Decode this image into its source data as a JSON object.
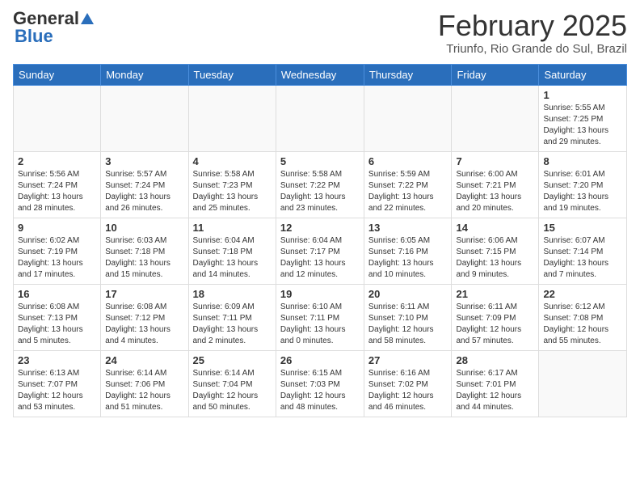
{
  "header": {
    "logo_general": "General",
    "logo_blue": "Blue",
    "month_title": "February 2025",
    "location": "Triunfo, Rio Grande do Sul, Brazil"
  },
  "days_of_week": [
    "Sunday",
    "Monday",
    "Tuesday",
    "Wednesday",
    "Thursday",
    "Friday",
    "Saturday"
  ],
  "weeks": [
    [
      {
        "num": "",
        "info": ""
      },
      {
        "num": "",
        "info": ""
      },
      {
        "num": "",
        "info": ""
      },
      {
        "num": "",
        "info": ""
      },
      {
        "num": "",
        "info": ""
      },
      {
        "num": "",
        "info": ""
      },
      {
        "num": "1",
        "info": "Sunrise: 5:55 AM\nSunset: 7:25 PM\nDaylight: 13 hours and 29 minutes."
      }
    ],
    [
      {
        "num": "2",
        "info": "Sunrise: 5:56 AM\nSunset: 7:24 PM\nDaylight: 13 hours and 28 minutes."
      },
      {
        "num": "3",
        "info": "Sunrise: 5:57 AM\nSunset: 7:24 PM\nDaylight: 13 hours and 26 minutes."
      },
      {
        "num": "4",
        "info": "Sunrise: 5:58 AM\nSunset: 7:23 PM\nDaylight: 13 hours and 25 minutes."
      },
      {
        "num": "5",
        "info": "Sunrise: 5:58 AM\nSunset: 7:22 PM\nDaylight: 13 hours and 23 minutes."
      },
      {
        "num": "6",
        "info": "Sunrise: 5:59 AM\nSunset: 7:22 PM\nDaylight: 13 hours and 22 minutes."
      },
      {
        "num": "7",
        "info": "Sunrise: 6:00 AM\nSunset: 7:21 PM\nDaylight: 13 hours and 20 minutes."
      },
      {
        "num": "8",
        "info": "Sunrise: 6:01 AM\nSunset: 7:20 PM\nDaylight: 13 hours and 19 minutes."
      }
    ],
    [
      {
        "num": "9",
        "info": "Sunrise: 6:02 AM\nSunset: 7:19 PM\nDaylight: 13 hours and 17 minutes."
      },
      {
        "num": "10",
        "info": "Sunrise: 6:03 AM\nSunset: 7:18 PM\nDaylight: 13 hours and 15 minutes."
      },
      {
        "num": "11",
        "info": "Sunrise: 6:04 AM\nSunset: 7:18 PM\nDaylight: 13 hours and 14 minutes."
      },
      {
        "num": "12",
        "info": "Sunrise: 6:04 AM\nSunset: 7:17 PM\nDaylight: 13 hours and 12 minutes."
      },
      {
        "num": "13",
        "info": "Sunrise: 6:05 AM\nSunset: 7:16 PM\nDaylight: 13 hours and 10 minutes."
      },
      {
        "num": "14",
        "info": "Sunrise: 6:06 AM\nSunset: 7:15 PM\nDaylight: 13 hours and 9 minutes."
      },
      {
        "num": "15",
        "info": "Sunrise: 6:07 AM\nSunset: 7:14 PM\nDaylight: 13 hours and 7 minutes."
      }
    ],
    [
      {
        "num": "16",
        "info": "Sunrise: 6:08 AM\nSunset: 7:13 PM\nDaylight: 13 hours and 5 minutes."
      },
      {
        "num": "17",
        "info": "Sunrise: 6:08 AM\nSunset: 7:12 PM\nDaylight: 13 hours and 4 minutes."
      },
      {
        "num": "18",
        "info": "Sunrise: 6:09 AM\nSunset: 7:11 PM\nDaylight: 13 hours and 2 minutes."
      },
      {
        "num": "19",
        "info": "Sunrise: 6:10 AM\nSunset: 7:11 PM\nDaylight: 13 hours and 0 minutes."
      },
      {
        "num": "20",
        "info": "Sunrise: 6:11 AM\nSunset: 7:10 PM\nDaylight: 12 hours and 58 minutes."
      },
      {
        "num": "21",
        "info": "Sunrise: 6:11 AM\nSunset: 7:09 PM\nDaylight: 12 hours and 57 minutes."
      },
      {
        "num": "22",
        "info": "Sunrise: 6:12 AM\nSunset: 7:08 PM\nDaylight: 12 hours and 55 minutes."
      }
    ],
    [
      {
        "num": "23",
        "info": "Sunrise: 6:13 AM\nSunset: 7:07 PM\nDaylight: 12 hours and 53 minutes."
      },
      {
        "num": "24",
        "info": "Sunrise: 6:14 AM\nSunset: 7:06 PM\nDaylight: 12 hours and 51 minutes."
      },
      {
        "num": "25",
        "info": "Sunrise: 6:14 AM\nSunset: 7:04 PM\nDaylight: 12 hours and 50 minutes."
      },
      {
        "num": "26",
        "info": "Sunrise: 6:15 AM\nSunset: 7:03 PM\nDaylight: 12 hours and 48 minutes."
      },
      {
        "num": "27",
        "info": "Sunrise: 6:16 AM\nSunset: 7:02 PM\nDaylight: 12 hours and 46 minutes."
      },
      {
        "num": "28",
        "info": "Sunrise: 6:17 AM\nSunset: 7:01 PM\nDaylight: 12 hours and 44 minutes."
      },
      {
        "num": "",
        "info": ""
      }
    ]
  ]
}
